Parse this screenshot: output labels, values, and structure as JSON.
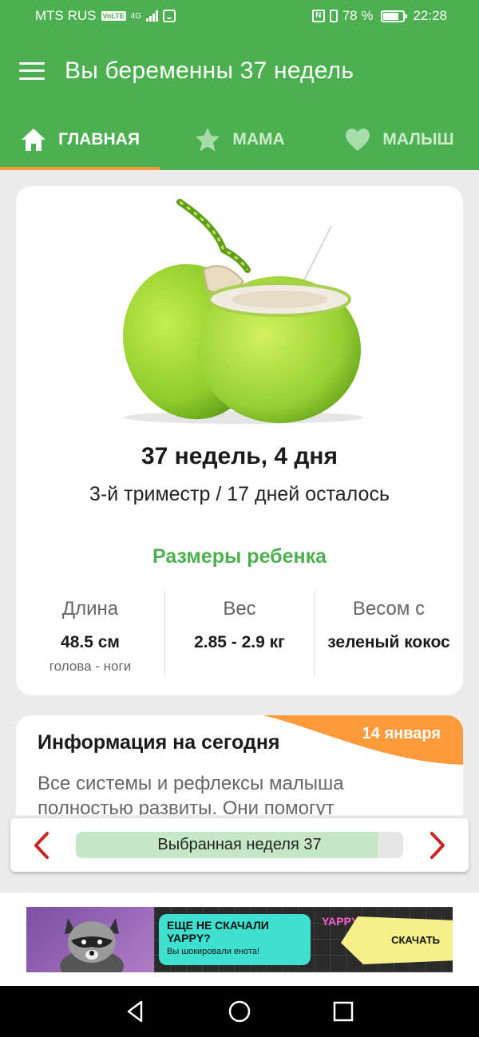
{
  "status_bar": {
    "carrier": "MTS RUS",
    "volte": "VoLTE",
    "network": "4G",
    "battery_percent": "78 %",
    "battery_level": 0.78,
    "time": "22:28"
  },
  "app_bar": {
    "title": "Вы беременны 37 недель",
    "menu_icon": "hamburger-menu-icon"
  },
  "tabs": [
    {
      "label": "ГЛАВНАЯ",
      "icon": "home-icon",
      "active": true
    },
    {
      "label": "МАМА",
      "icon": "star-icon",
      "active": false
    },
    {
      "label": "МАЛЫШ",
      "icon": "heart-icon",
      "active": false
    }
  ],
  "week_card": {
    "image": "green-coconut",
    "week_title": "37 недель, 4 дня",
    "subtitle": "3-й триместр / 17 дней осталось",
    "sizes_title": "Размеры ребенка",
    "stats": [
      {
        "label": "Длина",
        "value": "48.5 см",
        "note": "голова - ноги"
      },
      {
        "label": "Вес",
        "value": "2.85 - 2.9 кг",
        "note": ""
      },
      {
        "label": "Весом с",
        "value": "зеленый кокос",
        "note": ""
      }
    ]
  },
  "info_card": {
    "title": "Информация на сегодня",
    "date": "14 января",
    "text": "Все системы и рефлексы малыша полностью развиты. Они помогут"
  },
  "week_selector": {
    "label": "Выбранная неделя 37",
    "progress": 0.925,
    "prev_icon": "chevron-left-icon",
    "next_icon": "chevron-right-icon"
  },
  "ad": {
    "headline": "ЕЩЕ НЕ СКАЧАЛИ YAPPY?",
    "subtext": "Вы шокировали енота!",
    "brand": "YAPPY",
    "cta": "СКАЧАТЬ"
  },
  "colors": {
    "primary": "#4caf50",
    "accent": "#ff9a3c",
    "chevron": "#c62828",
    "progress_fill": "#c6e8c6"
  }
}
